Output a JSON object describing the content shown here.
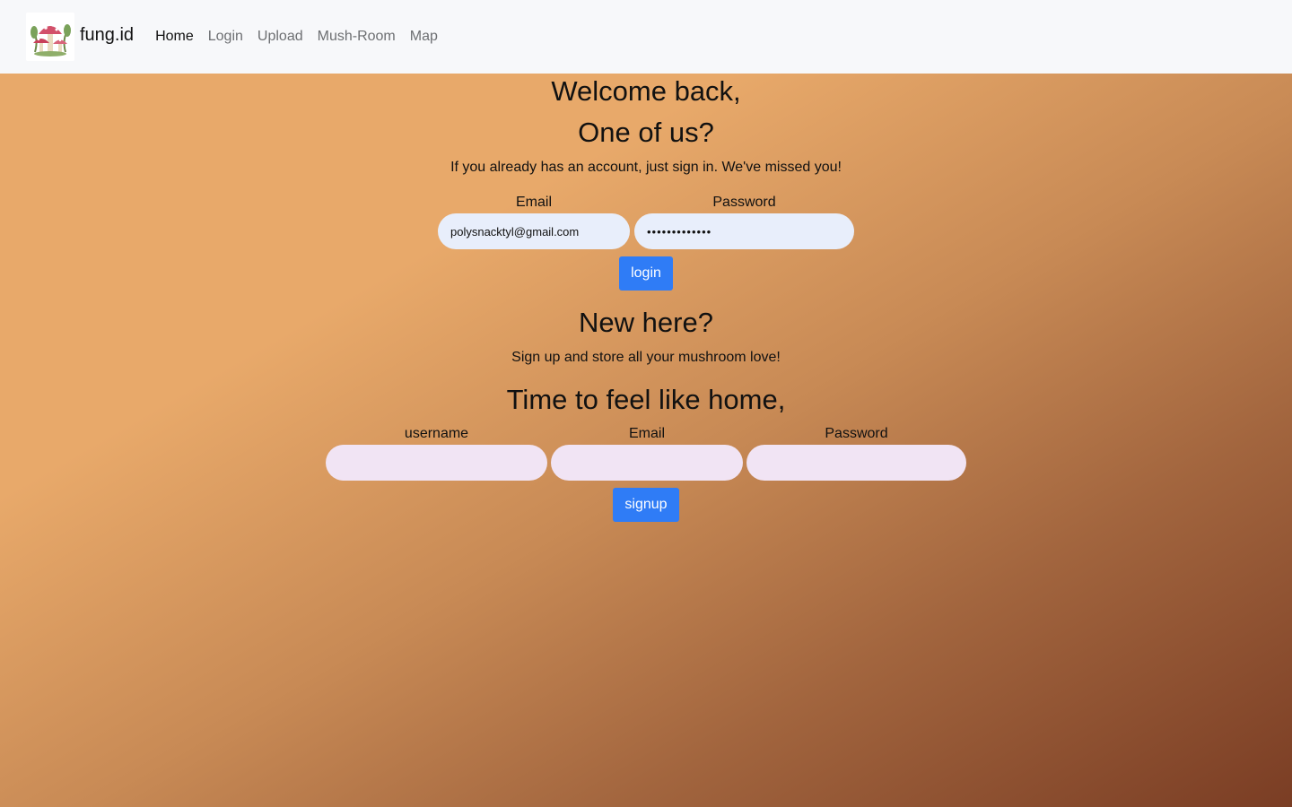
{
  "nav": {
    "brand": "fung.id",
    "links": [
      "Home",
      "Login",
      "Upload",
      "Mush-Room",
      "Map"
    ]
  },
  "login": {
    "heading1": "Welcome back,",
    "heading2": "One of us?",
    "subtitle": "If you already has an account, just sign in. We've missed you!",
    "email_label": "Email",
    "email_value": "polysnacktyl@gmail.com",
    "password_label": "Password",
    "password_value": "•••••••••••••",
    "button": "login"
  },
  "signup": {
    "heading1": "New here?",
    "subtitle": "Sign up and store all your mushroom love!",
    "heading2": "Time to feel like home,",
    "username_label": "username",
    "email_label": "Email",
    "password_label": "Password",
    "button": "signup"
  },
  "colors": {
    "navbar_bg": "#f7f8fa",
    "button_bg": "#2f7cf6",
    "login_input_bg": "#e8eefb",
    "signup_input_bg": "#f1e4f4",
    "gradient_start": "#e8a96a",
    "gradient_end": "#7a3d24"
  }
}
